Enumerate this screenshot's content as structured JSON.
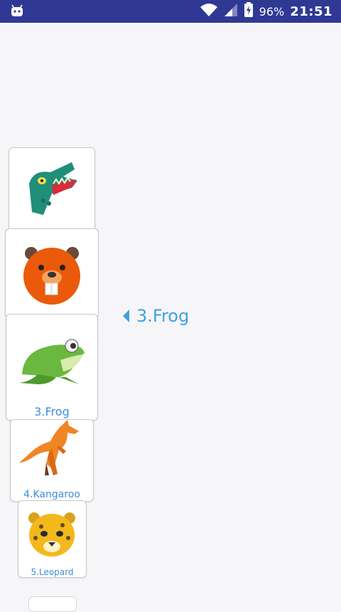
{
  "status_bar": {
    "battery_percent": "96%",
    "time": "21:51",
    "icons": [
      "android-icon",
      "wifi-icon",
      "signal-icon",
      "battery-icon"
    ]
  },
  "selection": {
    "label": "3.Frog"
  },
  "cards": [
    {
      "name": "crocodile",
      "label": ""
    },
    {
      "name": "beaver",
      "label": ""
    },
    {
      "name": "frog",
      "label": "3.Frog"
    },
    {
      "name": "kangaroo",
      "label": "4.Kangaroo"
    },
    {
      "name": "leopard",
      "label": "5.Leopard"
    }
  ],
  "colors": {
    "status_bar": "#2f3994",
    "accent": "#3fa0e0",
    "card_label": "#3a8fd8"
  }
}
